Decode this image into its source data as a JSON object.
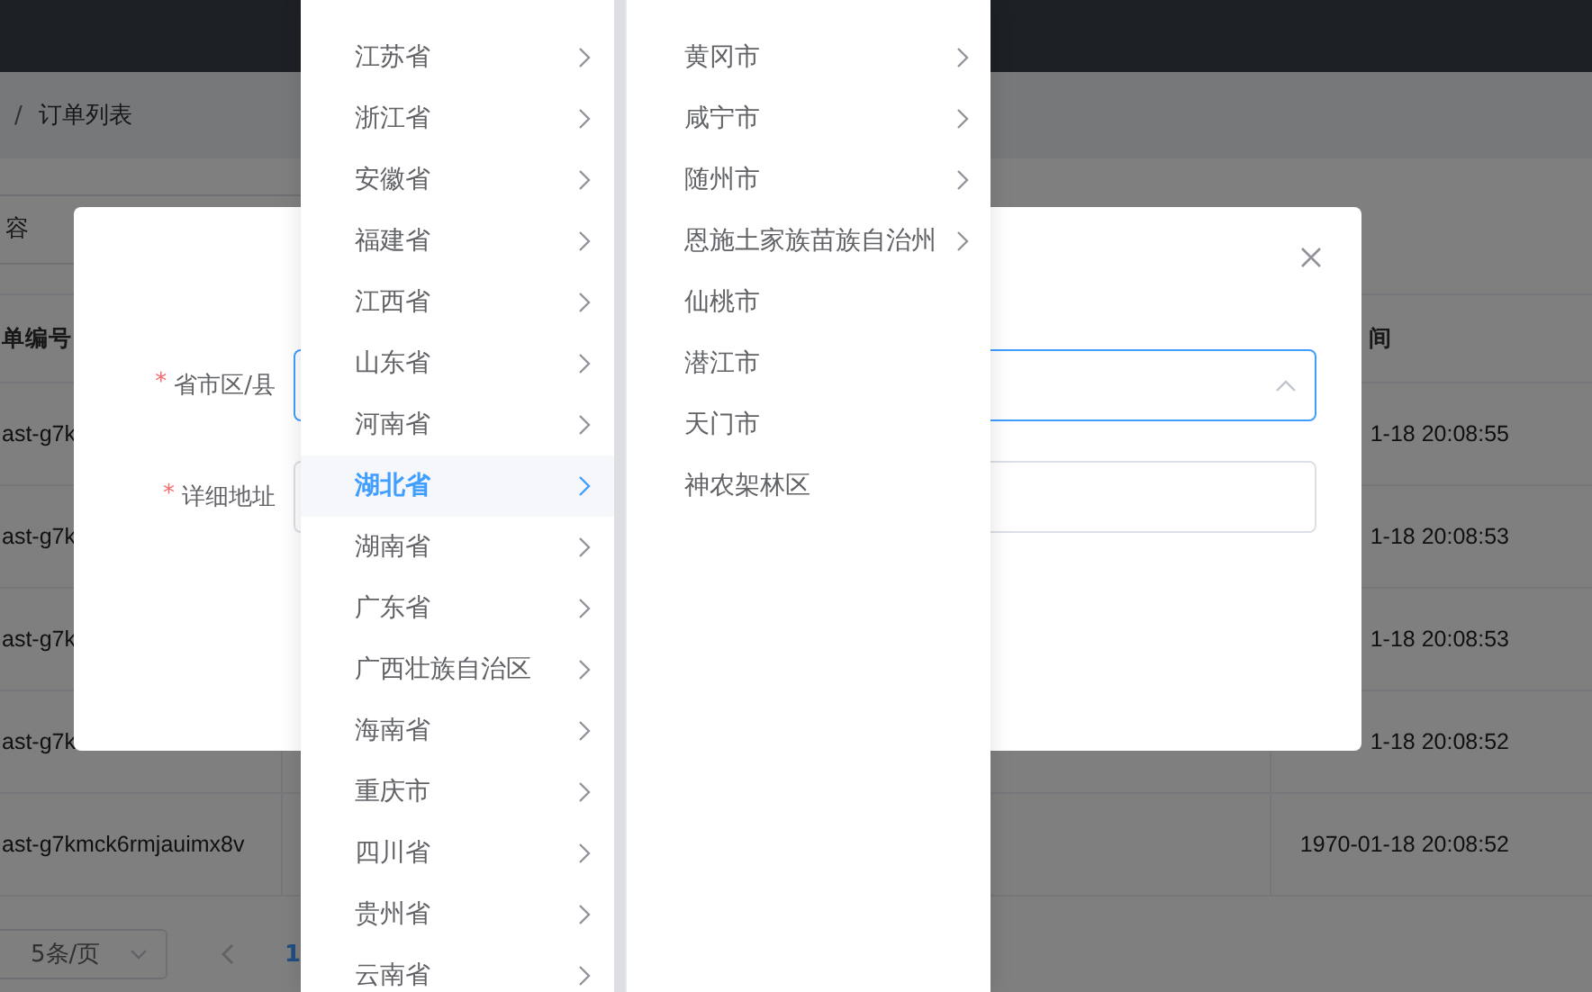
{
  "breadcrumb": {
    "separator": "/",
    "current": "订单列表"
  },
  "search": {
    "placeholder": "容"
  },
  "table": {
    "columns": [
      "单编号",
      "间"
    ],
    "rows": [
      {
        "order_no": "ast-g7k",
        "time": "1-18 20:08:55"
      },
      {
        "order_no": "ast-g7k",
        "time": "1-18 20:08:53"
      },
      {
        "order_no": "ast-g7k",
        "time": "1-18 20:08:53"
      },
      {
        "order_no": "ast-g7k",
        "time": "1-18 20:08:52"
      },
      {
        "order_no": "ast-g7kmck6rmjauimx8v",
        "time": "1970-01-18 20:08:52"
      }
    ]
  },
  "pagination": {
    "page_size": "5条/页",
    "current_page": "1"
  },
  "dialog": {
    "fields": [
      {
        "label": "省市区/县",
        "required_mark": "*",
        "kind": "cascader",
        "focused": true
      },
      {
        "label": "详细地址",
        "required_mark": "*",
        "kind": "input",
        "focused": false
      }
    ]
  },
  "cascader_menu": {
    "columns": [
      {
        "items": [
          {
            "label": "江苏省",
            "has_children": true,
            "selected": false
          },
          {
            "label": "浙江省",
            "has_children": true,
            "selected": false
          },
          {
            "label": "安徽省",
            "has_children": true,
            "selected": false
          },
          {
            "label": "福建省",
            "has_children": true,
            "selected": false
          },
          {
            "label": "江西省",
            "has_children": true,
            "selected": false
          },
          {
            "label": "山东省",
            "has_children": true,
            "selected": false
          },
          {
            "label": "河南省",
            "has_children": true,
            "selected": false
          },
          {
            "label": "湖北省",
            "has_children": true,
            "selected": true
          },
          {
            "label": "湖南省",
            "has_children": true,
            "selected": false
          },
          {
            "label": "广东省",
            "has_children": true,
            "selected": false
          },
          {
            "label": "广西壮族自治区",
            "has_children": true,
            "selected": false
          },
          {
            "label": "海南省",
            "has_children": true,
            "selected": false
          },
          {
            "label": "重庆市",
            "has_children": true,
            "selected": false
          },
          {
            "label": "四川省",
            "has_children": true,
            "selected": false
          },
          {
            "label": "贵州省",
            "has_children": true,
            "selected": false
          },
          {
            "label": "云南省",
            "has_children": true,
            "selected": false
          }
        ]
      },
      {
        "items": [
          {
            "label": "黄冈市",
            "has_children": true,
            "selected": false
          },
          {
            "label": "咸宁市",
            "has_children": true,
            "selected": false
          },
          {
            "label": "随州市",
            "has_children": true,
            "selected": false
          },
          {
            "label": "恩施土家族苗族自治州",
            "has_children": true,
            "selected": false
          },
          {
            "label": "仙桃市",
            "has_children": false,
            "selected": false
          },
          {
            "label": "潜江市",
            "has_children": false,
            "selected": false
          },
          {
            "label": "天门市",
            "has_children": false,
            "selected": false
          },
          {
            "label": "神农架林区",
            "has_children": false,
            "selected": false
          }
        ]
      }
    ]
  }
}
